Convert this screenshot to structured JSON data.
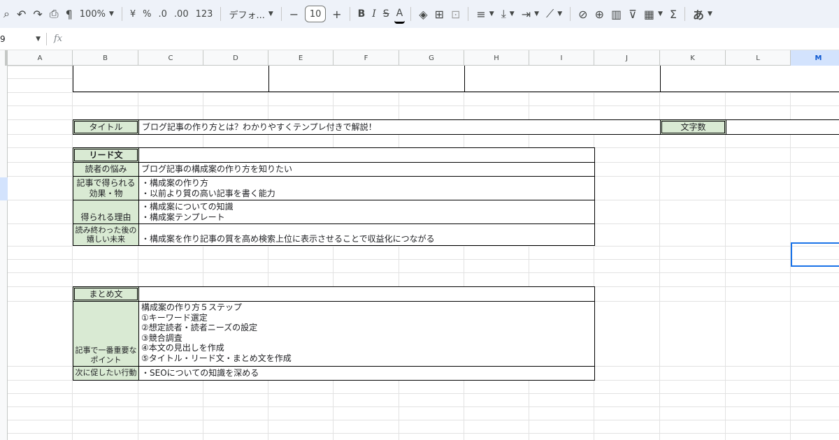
{
  "toolbar": {
    "zoom": "100%",
    "currency": "¥",
    "percent": "%",
    "dec_decrease": ".0",
    "dec_increase": ".00",
    "number_format": "123",
    "font_name": "デフォ...",
    "font_size": "10",
    "bold": "B",
    "italic": "I",
    "strikethrough": "S",
    "text_color": "A",
    "sum": "Σ",
    "input_tools": "あ"
  },
  "formula_bar": {
    "cell_ref": "9",
    "fx": "fx"
  },
  "columns": [
    "A",
    "B",
    "C",
    "D",
    "E",
    "F",
    "G",
    "H",
    "I",
    "J",
    "K",
    "L",
    "M"
  ],
  "selected_column": "M",
  "sheet": {
    "title_label": "タイトル",
    "title_value": "ブログ記事の作り方とは？わかりやすくテンプレ付きで解説！",
    "char_count_label": "文字数",
    "lead_header": "リード文",
    "lead_rows": [
      {
        "label": "読者の悩み",
        "value": "ブログ記事の構成案の作り方を知りたい"
      },
      {
        "label": "記事で得られる\n効果・物",
        "value": "・構成案の作り方\n・以前より質の高い記事を書く能力"
      },
      {
        "label": "得られる理由",
        "value": "・構成案についての知識\n・構成案テンプレート"
      },
      {
        "label": "読み終わった後の\n嬉しい未来",
        "value": "・構成案を作り記事の質を高め検索上位に表示させることで収益化につながる"
      }
    ],
    "summary_header": "まとめ文",
    "summary_rows": [
      {
        "label": "記事で一番重要な\nポイント",
        "value": "構成案の作り方５ステップ\n①キーワード選定\n②想定読者・読者ニーズの設定\n③競合調査\n④本文の見出しを作成\n⑤タイトル・リード文・まとめ文を作成"
      },
      {
        "label": "次に促したい行動",
        "value": "・SEOについての知識を深める"
      }
    ]
  }
}
